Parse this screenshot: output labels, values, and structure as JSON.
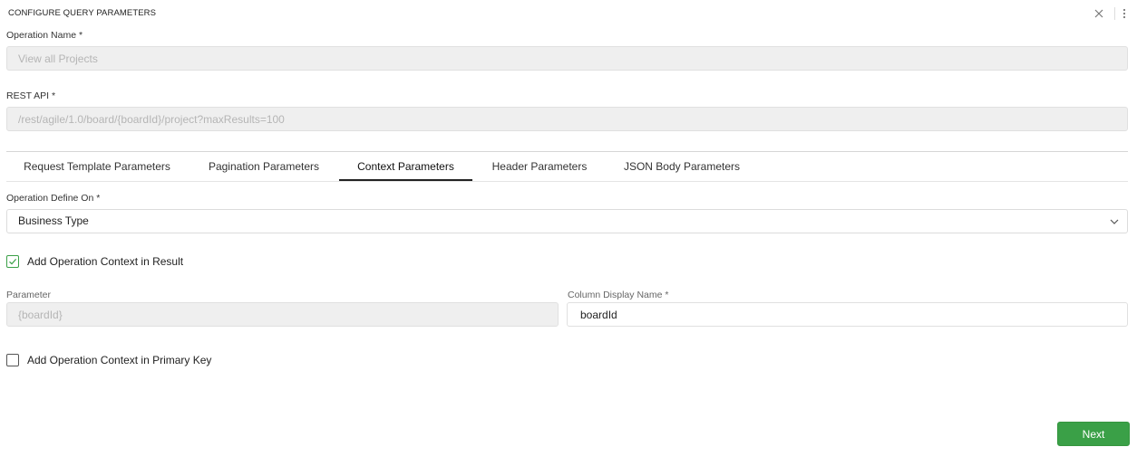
{
  "dialog": {
    "title": "CONFIGURE QUERY PARAMETERS",
    "icons": {
      "close": "close-icon",
      "more": "more-vertical-icon"
    }
  },
  "operation_name": {
    "label": "Operation Name *",
    "value": "View all Projects"
  },
  "rest_api": {
    "label": "REST API *",
    "value": "/rest/agile/1.0/board/{boardId}/project?maxResults=100"
  },
  "tabs": [
    {
      "label": "Request Template Parameters",
      "active": false
    },
    {
      "label": "Pagination Parameters",
      "active": false
    },
    {
      "label": "Context Parameters",
      "active": true
    },
    {
      "label": "Header Parameters",
      "active": false
    },
    {
      "label": "JSON Body Parameters",
      "active": false
    }
  ],
  "operation_define_on": {
    "label": "Operation Define On *",
    "value": "Business Type"
  },
  "context_in_result": {
    "label": "Add Operation Context in Result",
    "checked": true
  },
  "parameter": {
    "label": "Parameter",
    "value": "{boardId}"
  },
  "column_display_name": {
    "label": "Column Display Name *",
    "value": "boardId"
  },
  "context_in_primary_key": {
    "label": "Add Operation Context in Primary Key",
    "checked": false
  },
  "footer": {
    "next_label": "Next"
  },
  "colors": {
    "accent_green": "#3aa047",
    "disabled_bg": "#efefef"
  }
}
